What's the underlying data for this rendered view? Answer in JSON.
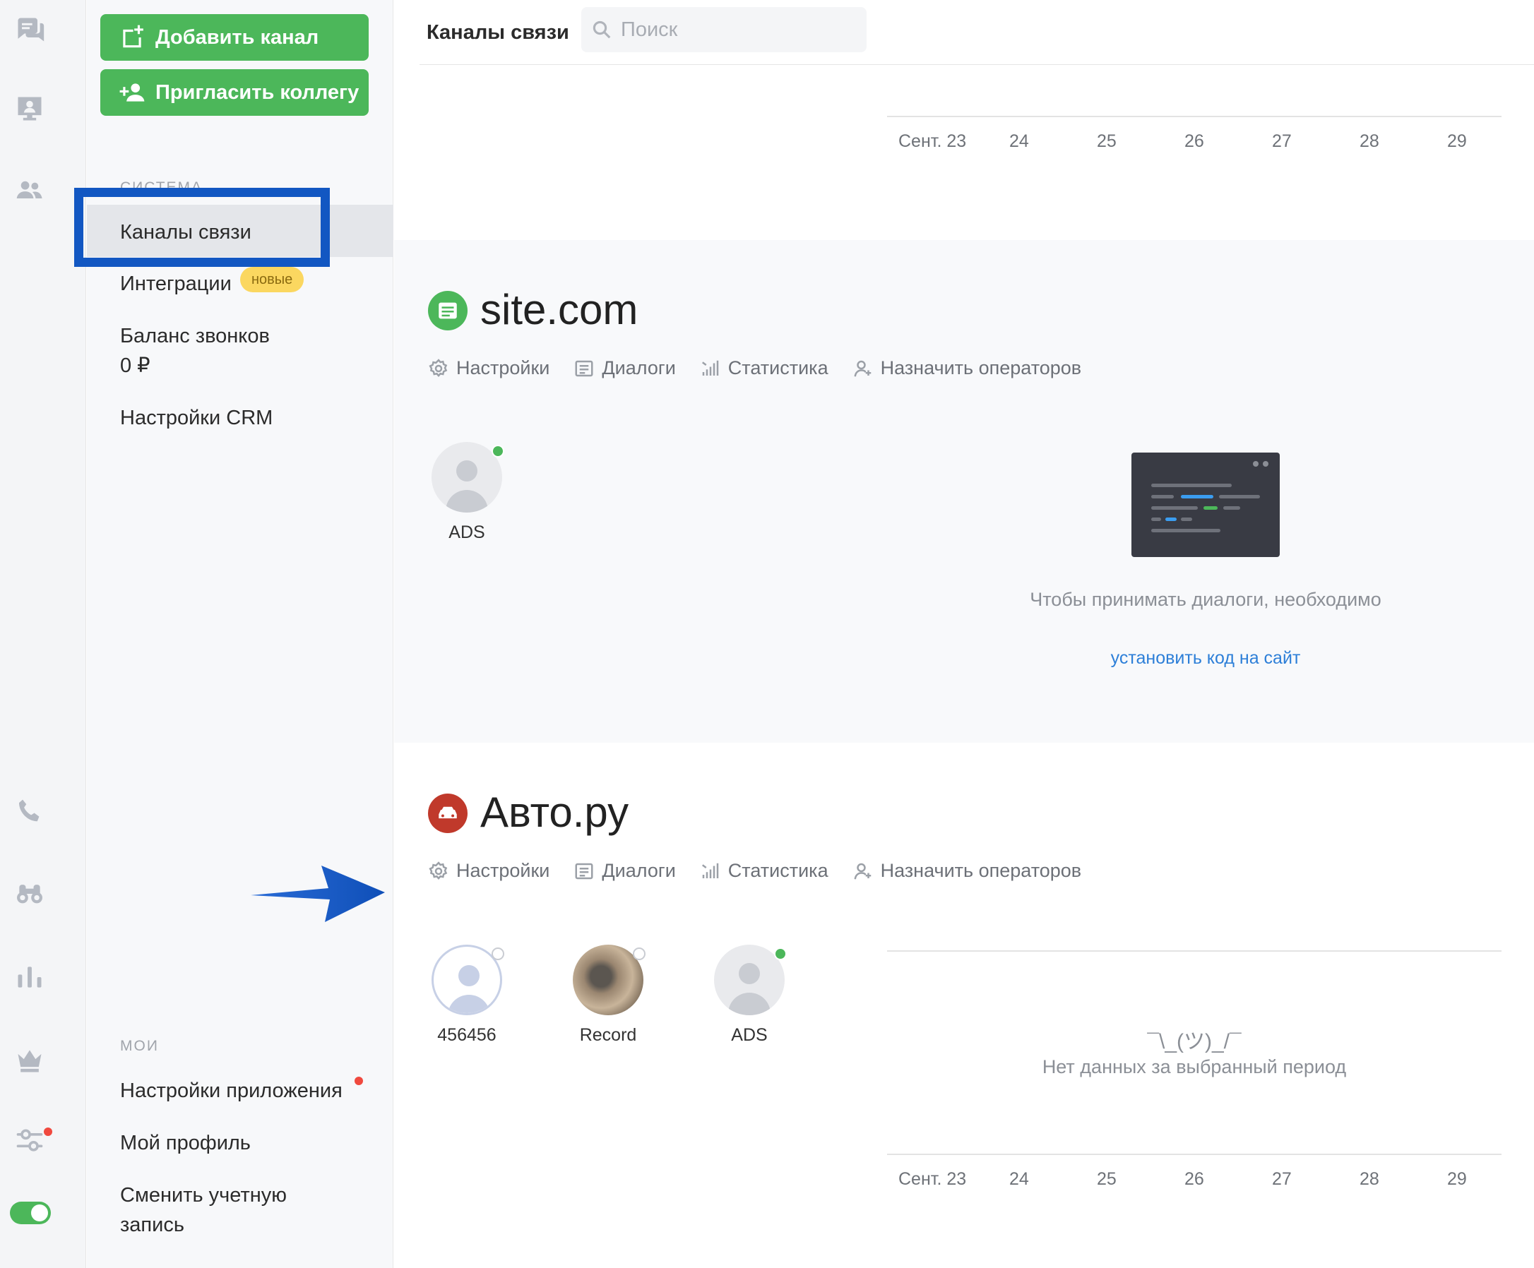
{
  "rail": {
    "icons": [
      "chat-icon",
      "monitor-user-icon",
      "users-icon",
      "phone-icon",
      "binoculars-icon",
      "bar-chart-icon",
      "crown-icon",
      "sliders-icon"
    ],
    "colors": {
      "icon": "#b4b9c2",
      "toggle": "#4cb75a",
      "notification": "#f0493e"
    }
  },
  "nav": {
    "add_channel": "Добавить канал",
    "invite_colleague": "Пригласить коллегу",
    "system_label": "СИСТЕМА",
    "items": {
      "channels": "Каналы связи",
      "integrations": "Интеграции",
      "integrations_badge": "новые",
      "call_balance": "Баланс звонков",
      "call_balance_value": "0 ₽",
      "crm_settings": "Настройки CRM"
    },
    "my_label": "МОИ",
    "my_items": {
      "app_settings": "Настройки приложения",
      "my_profile": "Мой профиль",
      "switch_account_1": "Сменить учетную",
      "switch_account_2": "запись"
    },
    "colors": {
      "button": "#4cb75a",
      "highlight": "#1257c2",
      "badge": "#fbd760"
    }
  },
  "header": {
    "title": "Каналы связи",
    "search_placeholder": "Поиск"
  },
  "axis_ticks": [
    "Сент. 23",
    "24",
    "25",
    "26",
    "27",
    "28",
    "29"
  ],
  "tabs": {
    "settings": "Настройки",
    "dialogs": "Диалоги",
    "statistics": "Статистика",
    "assign_operators": "Назначить операторов"
  },
  "channel1": {
    "name": "site.com",
    "icon": "browser-icon",
    "color": "#4cb75a",
    "operators": [
      {
        "name": "ADS",
        "status": "online"
      }
    ],
    "message": "Чтобы принимать диалоги, необходимо",
    "link": "установить код на сайт"
  },
  "channel2": {
    "name": "Авто.ру",
    "icon": "car-icon",
    "color": "#c0392b",
    "operators": [
      {
        "name": "456456",
        "status": "offline"
      },
      {
        "name": "Record",
        "status": "offline"
      },
      {
        "name": "ADS",
        "status": "online"
      }
    ],
    "shrug": "¯\\_(ツ)_/¯",
    "no_data": "Нет данных за выбранный период"
  }
}
